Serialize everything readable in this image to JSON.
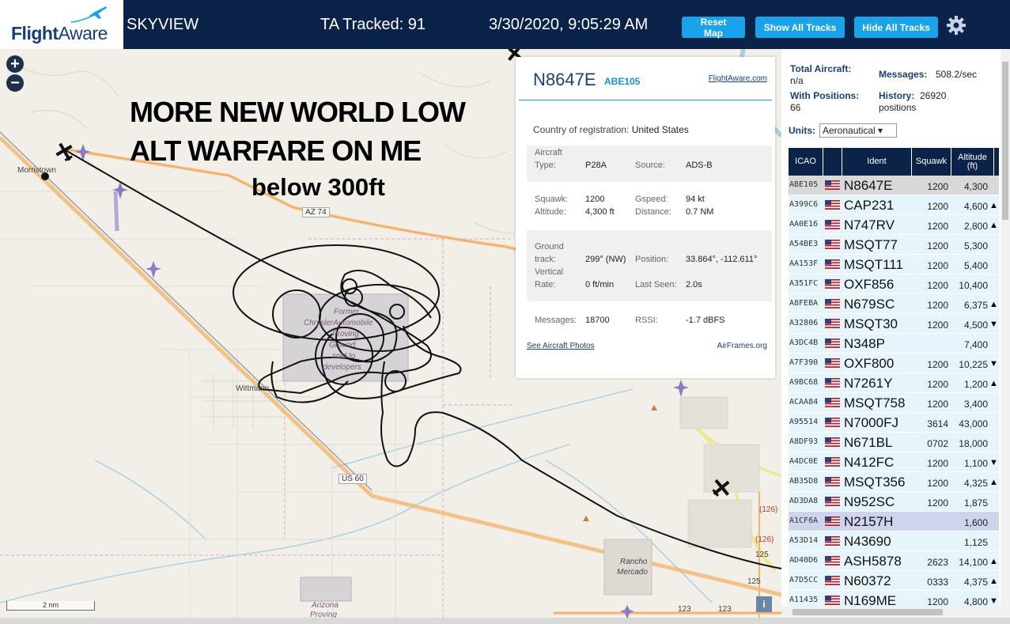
{
  "header": {
    "brand_bold": "Flight",
    "brand_light": "Aware",
    "app_name": "SKYVIEW",
    "tracked": "TA Tracked: 91",
    "datetime": "3/30/2020, 9:05:29 AM",
    "buttons": {
      "reset_map": "Reset Map",
      "show_all": "Show All Tracks",
      "hide_all": "Hide All Tracks"
    },
    "icons": {
      "settings": "gear-icon",
      "logo": "plane-icon"
    }
  },
  "map": {
    "zoom_in": "+",
    "zoom_out": "−",
    "annotation": {
      "line1": "MORE NEW WORLD LOW",
      "line2": "ALT WARFARE ON ME",
      "line3": "below 300ft"
    },
    "places": {
      "morristown": "Morristown",
      "wittmann": "Wittmann",
      "former1": "Former",
      "former2": "ChryslerAutomobile",
      "former3": "Proving",
      "former4": "Ground",
      "former5": "sold to",
      "former6": "developers",
      "rancho1": "Rancho",
      "rancho2": "Mercado",
      "arizona1": "Arizona",
      "arizona2": "Proving"
    },
    "roads": {
      "az74": "AZ 74",
      "us60": "US 60",
      "r126a": "(126)",
      "r126b": "(126)",
      "r125": "125",
      "r125b": "125",
      "r123": "123",
      "r123b": "123"
    },
    "scale": "2 nm",
    "info": "i"
  },
  "popup": {
    "registration": "N8647E",
    "ident": "ABE105",
    "link": "FlightAware.com",
    "country_label": "Country of registration:",
    "country_value": "United States",
    "aircraft_type_label": "Aircraft\nType:",
    "aircraft_type_value": "P28A",
    "source_label": "Source:",
    "source_value": "ADS-B",
    "squawk_label": "Squawk:",
    "squawk_value": "1200",
    "gspeed_label": "Gspeed:",
    "gspeed_value": "94 kt",
    "altitude_label": "Altitude:",
    "altitude_value": "4,300 ft",
    "distance_label": "Distance:",
    "distance_value": "0.7 NM",
    "ground_track_label": "Ground\ntrack:",
    "ground_track_value": "299° (NW)",
    "position_label": "Position:",
    "position_value": "33.864°, -112.611°",
    "vertical_rate_label": "Vertical\nRate:",
    "vertical_rate_value": "0 ft/min",
    "last_seen_label": "Last Seen:",
    "last_seen_value": "2.0s",
    "messages_label": "Messages:",
    "messages_value": "18700",
    "rssi_label": "RSSI:",
    "rssi_value": "-1.7 dBFS",
    "photos_link": "See Aircraft Photos",
    "airframes_link": "AirFrames.org"
  },
  "panel": {
    "total_label": "Total Aircraft:",
    "total_value": "n/a",
    "positions_label": "With Positions:",
    "positions_value": "66",
    "messages_label": "Messages:",
    "messages_value": "508.2/sec",
    "history_label": "History:",
    "history_value": "26920",
    "history_unit": "positions",
    "units_label": "Units:",
    "units_value": "Aeronautical ▾",
    "columns": [
      "ICAO",
      "",
      "Ident",
      "Squawk",
      "Altitude (ft)"
    ],
    "rows": [
      {
        "icao": "ABE105",
        "ident": "N8647E",
        "squawk": "1200",
        "alt": "4,300",
        "trend": ""
      },
      {
        "icao": "A399C6",
        "ident": "CAP231",
        "squawk": "1200",
        "alt": "4,600",
        "trend": "▲"
      },
      {
        "icao": "AA0E16",
        "ident": "N747RV",
        "squawk": "1200",
        "alt": "2,800",
        "trend": "▲"
      },
      {
        "icao": "A54BE3",
        "ident": "MSQT77",
        "squawk": "1200",
        "alt": "5,300",
        "trend": ""
      },
      {
        "icao": "AA153F",
        "ident": "MSQT111",
        "squawk": "1200",
        "alt": "5,400",
        "trend": ""
      },
      {
        "icao": "A351FC",
        "ident": "OXF856",
        "squawk": "1200",
        "alt": "10,400",
        "trend": ""
      },
      {
        "icao": "A8FEBA",
        "ident": "N679SC",
        "squawk": "1200",
        "alt": "6,375",
        "trend": "▲"
      },
      {
        "icao": "A32806",
        "ident": "MSQT30",
        "squawk": "1200",
        "alt": "4,500",
        "trend": "▼"
      },
      {
        "icao": "A3DC4B",
        "ident": "N348P",
        "squawk": "",
        "alt": "7,400",
        "trend": ""
      },
      {
        "icao": "A7F390",
        "ident": "OXF800",
        "squawk": "1200",
        "alt": "10,225",
        "trend": "▼"
      },
      {
        "icao": "A9BC68",
        "ident": "N7261Y",
        "squawk": "1200",
        "alt": "1,200",
        "trend": "▲"
      },
      {
        "icao": "ACAA84",
        "ident": "MSQT758",
        "squawk": "1200",
        "alt": "3,400",
        "trend": ""
      },
      {
        "icao": "A95514",
        "ident": "N7000FJ",
        "squawk": "3614",
        "alt": "43,000",
        "trend": ""
      },
      {
        "icao": "A8DF93",
        "ident": "N671BL",
        "squawk": "0702",
        "alt": "18,000",
        "trend": ""
      },
      {
        "icao": "A4DC0E",
        "ident": "N412FC",
        "squawk": "1200",
        "alt": "1,100",
        "trend": "▼"
      },
      {
        "icao": "AB35D8",
        "ident": "MSQT356",
        "squawk": "1200",
        "alt": "4,325",
        "trend": "▲"
      },
      {
        "icao": "AD3DA8",
        "ident": "N952SC",
        "squawk": "1200",
        "alt": "1,875",
        "trend": ""
      },
      {
        "icao": "A1CF6A",
        "ident": "N2157H",
        "squawk": "",
        "alt": "1,600",
        "trend": ""
      },
      {
        "icao": "A53D14",
        "ident": "N43690",
        "squawk": "",
        "alt": "1,125",
        "trend": ""
      },
      {
        "icao": "AD40D6",
        "ident": "ASH5878",
        "squawk": "2623",
        "alt": "14,100",
        "trend": "▲"
      },
      {
        "icao": "A7D5CC",
        "ident": "N60372",
        "squawk": "0333",
        "alt": "4,375",
        "trend": "▲"
      },
      {
        "icao": "A11435",
        "ident": "N169ME",
        "squawk": "1200",
        "alt": "4,800",
        "trend": "▼"
      }
    ]
  },
  "colors": {
    "header_bg": "#0b2348",
    "button_blue": "#1aa3e8",
    "brand_navy": "#1b3f74",
    "row_bg": "#e6f4fb",
    "track_line": "#111111"
  }
}
